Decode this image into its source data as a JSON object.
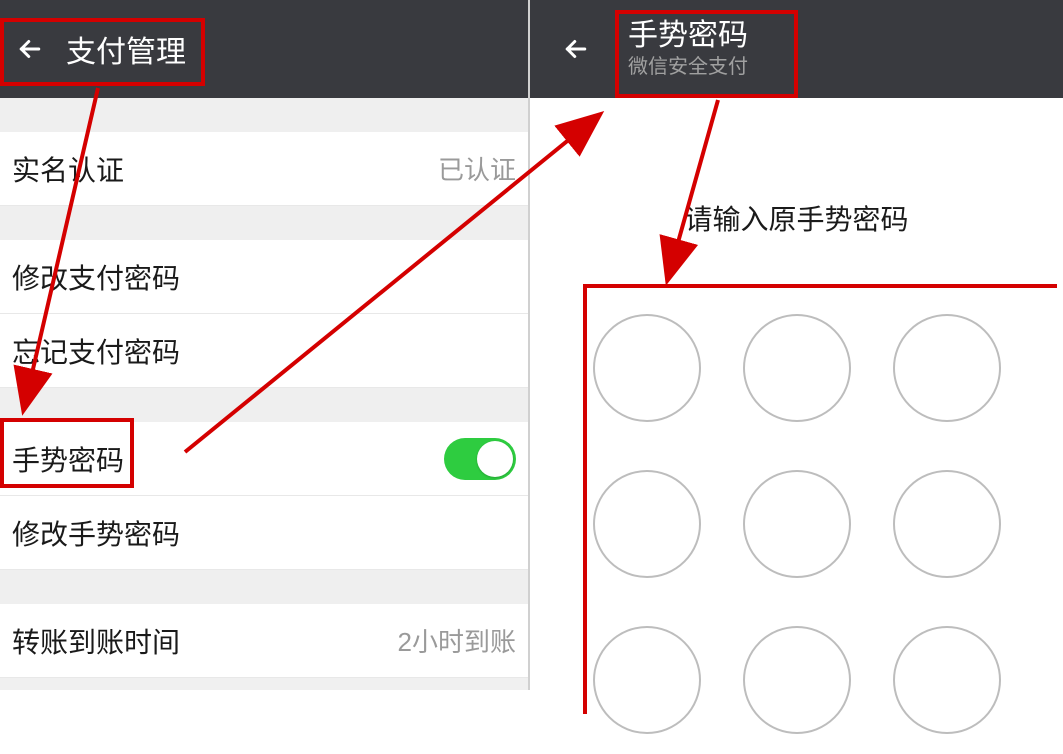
{
  "left": {
    "header": {
      "title": "支付管理"
    },
    "items": {
      "verify": {
        "label": "实名认证",
        "value": "已认证"
      },
      "change_pwd": {
        "label": "修改支付密码"
      },
      "forgot_pwd": {
        "label": "忘记支付密码"
      },
      "gesture": {
        "label": "手势密码"
      },
      "change_gesture": {
        "label": "修改手势密码"
      },
      "transfer_time": {
        "label": "转账到账时间",
        "value": "2小时到账"
      }
    }
  },
  "right": {
    "header": {
      "title": "手势密码",
      "subtitle": "微信安全支付"
    },
    "prompt": "请输入原手势密码"
  }
}
